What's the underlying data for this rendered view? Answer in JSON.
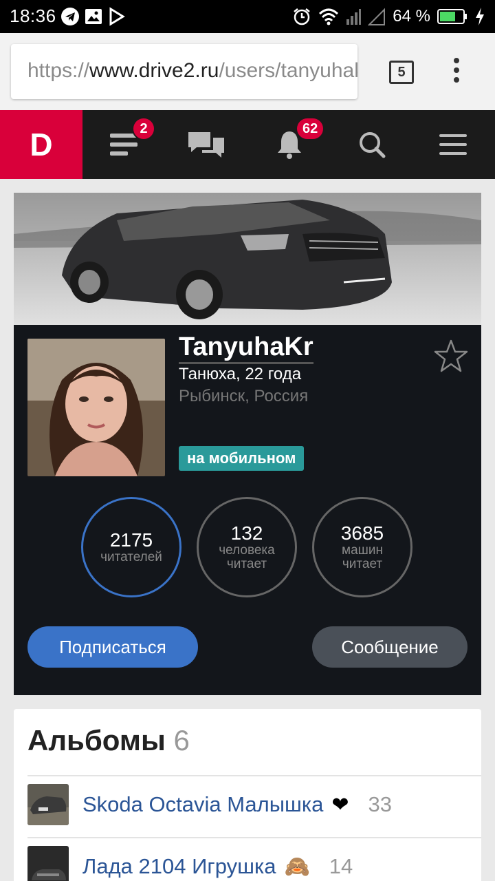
{
  "status_bar": {
    "time": "18:36",
    "battery_percent": "64 %",
    "icons": [
      "telegram-icon",
      "gallery-icon",
      "play-store-icon",
      "alarm-icon",
      "wifi-icon",
      "signal-icon",
      "battery-icon",
      "charging-icon"
    ]
  },
  "browser": {
    "url_scheme": "https://",
    "url_host": "www.drive2.ru",
    "url_path": "/users/tanyuhakr",
    "tab_count": "5"
  },
  "site_header": {
    "logo": "D",
    "feed_badge": "2",
    "notifications_badge": "62",
    "accent": "#d9003a"
  },
  "profile": {
    "username": "TanyuhaKr",
    "name_age": "Танюха, 22 года",
    "location": "Рыбинск, Россия",
    "status_badge": "на мобильном",
    "stats": [
      {
        "value": "2175",
        "label_1": "читателей",
        "label_2": ""
      },
      {
        "value": "132",
        "label_1": "человека",
        "label_2": "читает"
      },
      {
        "value": "3685",
        "label_1": "машин",
        "label_2": "читает"
      }
    ],
    "subscribe_label": "Подписаться",
    "message_label": "Сообщение"
  },
  "albums": {
    "title": "Альбомы",
    "count": "6",
    "items": [
      {
        "name": "Skoda Octavia Малышка",
        "emoji": "❤",
        "count": "33"
      },
      {
        "name": "Лада 2104 Игрушка",
        "emoji": "🙈",
        "count": "14"
      }
    ]
  }
}
